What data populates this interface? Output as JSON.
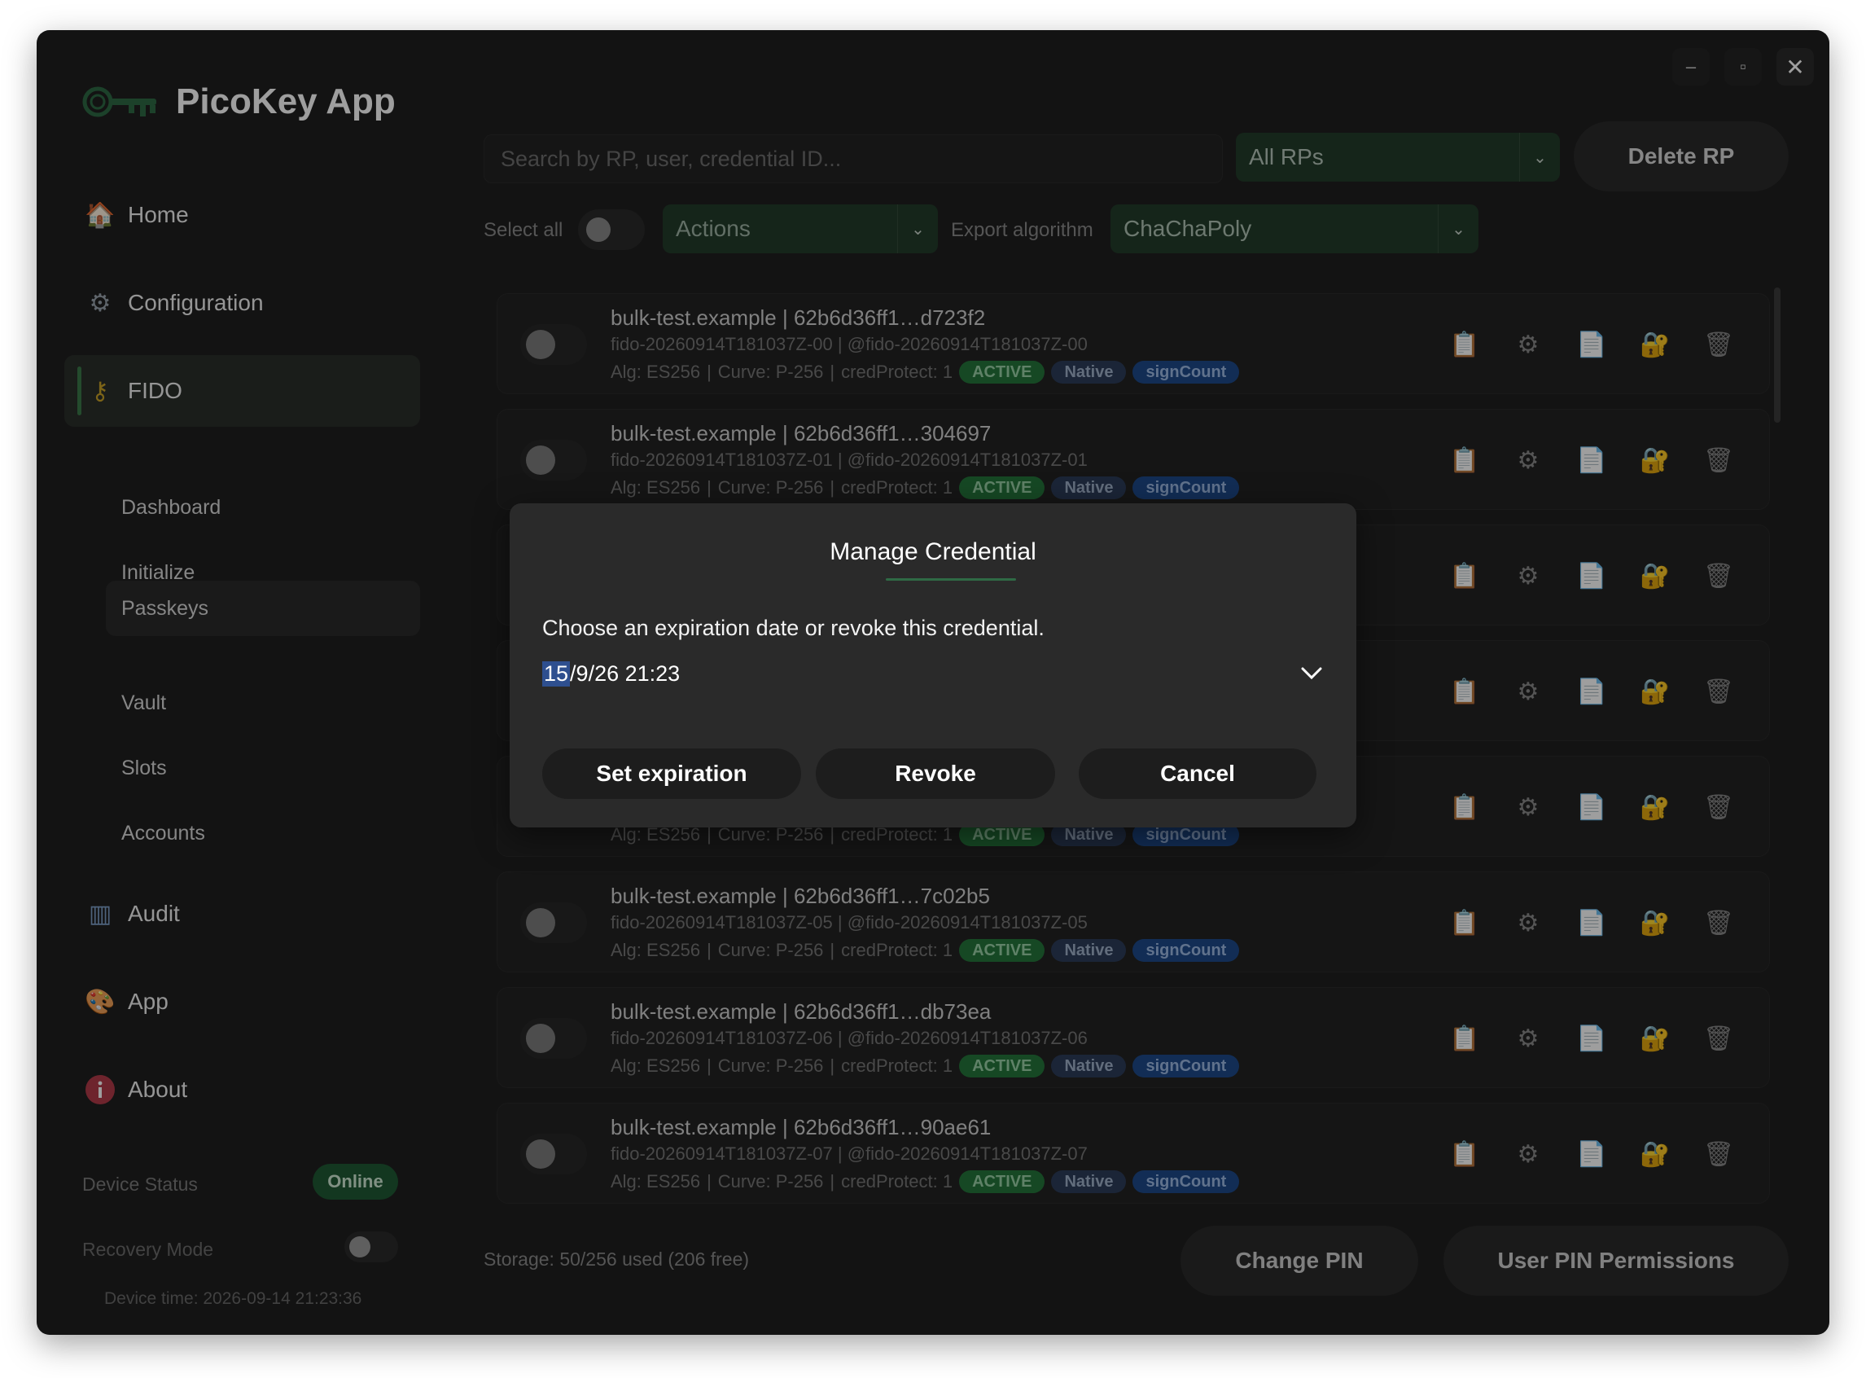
{
  "app": {
    "title": "PicoKey App"
  },
  "window_controls": {
    "minimize": "–",
    "maximize": "▫",
    "close": "✕"
  },
  "sidebar": {
    "nav": [
      {
        "id": "home",
        "label": "Home",
        "icon": "house-icon"
      },
      {
        "id": "configuration",
        "label": "Configuration",
        "icon": "gear-icon"
      },
      {
        "id": "fido",
        "label": "FIDO",
        "icon": "key-person-icon",
        "active": true
      },
      {
        "id": "audit",
        "label": "Audit",
        "icon": "chart-icon"
      },
      {
        "id": "app",
        "label": "App",
        "icon": "palette-icon"
      },
      {
        "id": "about",
        "label": "About",
        "icon": "info-icon"
      }
    ],
    "fido_sub": [
      "Dashboard",
      "Initialize",
      "Passkeys",
      "Vault",
      "Slots",
      "Accounts"
    ],
    "active_sub": "Passkeys",
    "device_status_label": "Device Status",
    "device_status_value": "Online",
    "recovery_mode_label": "Recovery Mode",
    "device_time": "Device time: 2026-09-14 21:23:36"
  },
  "toolbar": {
    "search_placeholder": "Search by RP, user, credential ID...",
    "rp_filter": "All RPs",
    "delete_rp": "Delete RP",
    "select_all": "Select all",
    "actions": "Actions",
    "export_algorithm_label": "Export algorithm",
    "export_algorithm": "ChaChaPoly"
  },
  "credentials": [
    {
      "rp": "bulk-test.example",
      "id": "62b6d36ff1…d723f2",
      "user": "fido-20260914T181037Z-00",
      "handle": "@fido-20260914T181037Z-00",
      "alg": "Alg: ES256",
      "curve": "Curve: P-256",
      "cred_protect": "credProtect: 1",
      "badges": [
        "ACTIVE",
        "Native",
        "signCount"
      ]
    },
    {
      "rp": "bulk-test.example",
      "id": "62b6d36ff1…304697",
      "user": "fido-20260914T181037Z-01",
      "handle": "@fido-20260914T181037Z-01",
      "alg": "Alg: ES256",
      "curve": "Curve: P-256",
      "cred_protect": "credProtect: 1",
      "badges": [
        "ACTIVE",
        "Native",
        "signCount"
      ]
    },
    {
      "rp": "",
      "id": "",
      "user": "",
      "handle": "",
      "alg": "",
      "curve": "",
      "cred_protect": "",
      "badges": []
    },
    {
      "rp": "",
      "id": "",
      "user": "",
      "handle": "",
      "alg": "",
      "curve": "",
      "cred_protect": "",
      "badges": []
    },
    {
      "rp": "",
      "id": "",
      "user": "",
      "handle": "",
      "alg": "Alg: ES256",
      "curve": "Curve: P-256",
      "cred_protect": "credProtect: 1",
      "badges": [
        "ACTIVE",
        "Native",
        "signCount"
      ]
    },
    {
      "rp": "bulk-test.example",
      "id": "62b6d36ff1…7c02b5",
      "user": "fido-20260914T181037Z-05",
      "handle": "@fido-20260914T181037Z-05",
      "alg": "Alg: ES256",
      "curve": "Curve: P-256",
      "cred_protect": "credProtect: 1",
      "badges": [
        "ACTIVE",
        "Native",
        "signCount"
      ]
    },
    {
      "rp": "bulk-test.example",
      "id": "62b6d36ff1…db73ea",
      "user": "fido-20260914T181037Z-06",
      "handle": "@fido-20260914T181037Z-06",
      "alg": "Alg: ES256",
      "curve": "Curve: P-256",
      "cred_protect": "credProtect: 1",
      "badges": [
        "ACTIVE",
        "Native",
        "signCount"
      ]
    },
    {
      "rp": "bulk-test.example",
      "id": "62b6d36ff1…90ae61",
      "user": "fido-20260914T181037Z-07",
      "handle": "@fido-20260914T181037Z-07",
      "alg": "Alg: ES256",
      "curve": "Curve: P-256",
      "cred_protect": "credProtect: 1",
      "badges": [
        "ACTIVE",
        "Native",
        "signCount"
      ]
    }
  ],
  "row_icons": [
    "clipboard-icon",
    "gear-icon",
    "document-icon",
    "lock-key-icon",
    "trash-icon"
  ],
  "footer": {
    "storage": "Storage: 50/256 used (206 free)",
    "change_pin": "Change PIN",
    "user_pin_permissions": "User PIN Permissions"
  },
  "modal": {
    "title": "Manage Credential",
    "message": "Choose an expiration date or revoke this credential.",
    "date_selected_part": "15",
    "date_rest": "/9/26 21:23",
    "set_expiration": "Set expiration",
    "revoke": "Revoke",
    "cancel": "Cancel"
  },
  "colors": {
    "background": "#1f1f1f",
    "accent_green": "#233d2b",
    "active_badge": "#24743a",
    "native_badge": "#2c3c5a",
    "signcount_badge": "#1e4a8a",
    "online": "#1f5a34"
  }
}
